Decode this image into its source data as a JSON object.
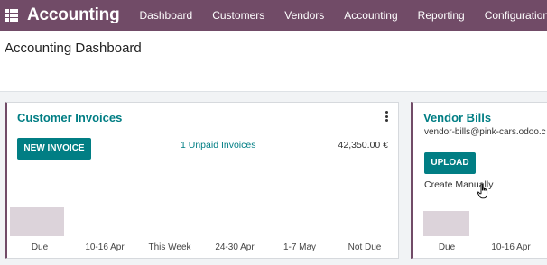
{
  "navbar": {
    "brand": "Accounting",
    "menu": [
      "Dashboard",
      "Customers",
      "Vendors",
      "Accounting",
      "Reporting",
      "Configuration"
    ],
    "background": "#714b67"
  },
  "page": {
    "title": "Accounting Dashboard"
  },
  "customer_invoices": {
    "title": "Customer Invoices",
    "new_button": "NEW INVOICE",
    "unpaid": "1 Unpaid Invoices",
    "amount": "42,350.00 €",
    "chart_labels": [
      "Due",
      "10-16 Apr",
      "This Week",
      "24-30 Apr",
      "1-7 May",
      "Not Due"
    ]
  },
  "vendor_bills": {
    "title": "Vendor Bills",
    "email": "vendor-bills@pink-cars.odoo.c",
    "upload_button": "UPLOAD",
    "create_link": "Create Manually",
    "chart_labels": [
      "Due",
      "10-16 Apr"
    ]
  },
  "colors": {
    "accent": "#017e84",
    "bar": "#dcd3da"
  }
}
